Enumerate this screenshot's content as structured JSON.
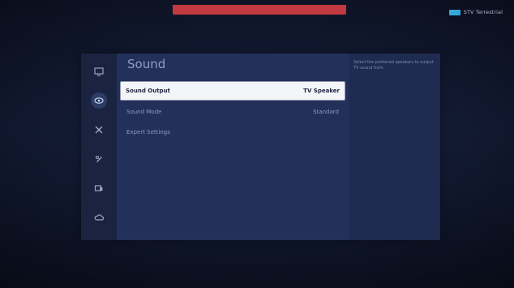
{
  "status": {
    "source_label": "STV Terrestrial",
    "colors": {
      "alert_bar": "#c23a3f",
      "source_badge": "#37a7d8"
    }
  },
  "rail": {
    "icons": [
      {
        "name": "picture-icon",
        "glyph": "▦"
      },
      {
        "name": "sound-icon",
        "glyph": "◉"
      },
      {
        "name": "broadcasting-icon",
        "glyph": "✕"
      },
      {
        "name": "general-icon",
        "glyph": "✥"
      },
      {
        "name": "support-icon",
        "glyph": "▣"
      },
      {
        "name": "cloud-icon",
        "glyph": "☁"
      }
    ],
    "active_index": 1
  },
  "menu": {
    "title": "Sound",
    "items": [
      {
        "label": "Sound Output",
        "value": "TV Speaker"
      },
      {
        "label": "Sound Mode",
        "value": "Standard"
      },
      {
        "label": "Expert Settings",
        "value": ""
      }
    ]
  },
  "help": {
    "text": "Select the preferred speakers to output TV sound from."
  }
}
